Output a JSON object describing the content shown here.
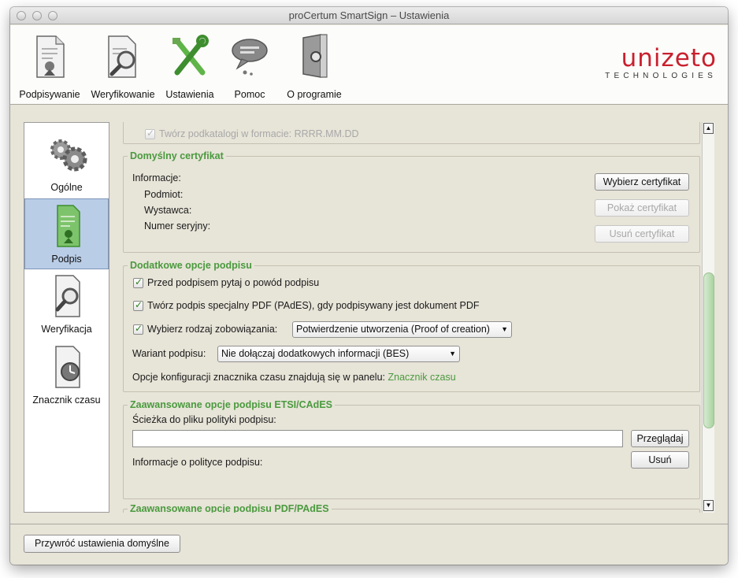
{
  "window": {
    "title": "proCertum SmartSign – Ustawienia"
  },
  "toolbar": {
    "items": [
      {
        "label": "Podpisywanie"
      },
      {
        "label": "Weryfikowanie"
      },
      {
        "label": "Ustawienia"
      },
      {
        "label": "Pomoc"
      },
      {
        "label": "O programie"
      }
    ],
    "logo_brand": "unizeto",
    "logo_sub": "TECHNOLOGIES"
  },
  "sidebar": {
    "items": [
      {
        "label": "Ogólne"
      },
      {
        "label": "Podpis"
      },
      {
        "label": "Weryfikacja"
      },
      {
        "label": "Znacznik czasu"
      }
    ],
    "selected": "Podpis"
  },
  "top_partial": {
    "checkbox_label": "Twórz podkatalogi w formacie: RRRR.MM.DD"
  },
  "default_cert": {
    "title": "Domyślny certyfikat",
    "info_label": "Informacje:",
    "subject_label": "Podmiot:",
    "issuer_label": "Wystawca:",
    "serial_label": "Numer seryjny:",
    "choose_button": "Wybierz certyfikat",
    "show_button": "Pokaż certyfikat",
    "remove_button": "Usuń certyfikat"
  },
  "extra_options": {
    "title": "Dodatkowe opcje podpisu",
    "ask_reason": "Przed podpisem pytaj o powód podpisu",
    "pades": "Twórz podpis specjalny PDF (PAdES), gdy podpisywany jest dokument PDF",
    "commitment_label": "Wybierz rodzaj zobowiązania:",
    "commitment_value": "Potwierdzenie utworzenia (Proof of creation)",
    "variant_label": "Wariant podpisu:",
    "variant_value": "Nie dołączaj dodatkowych informacji (BES)",
    "tsa_text": "Opcje konfiguracji znacznika czasu znajdują się w panelu:",
    "tsa_link": "Znacznik czasu"
  },
  "etsi": {
    "title": "Zaawansowane opcje podpisu ETSI/CAdES",
    "policy_path_label": "Ścieżka do pliku polityki podpisu:",
    "policy_path_value": "",
    "browse_button": "Przeglądaj",
    "policy_info_label": "Informacje o polityce podpisu:",
    "remove_button": "Usuń"
  },
  "pdf_pades": {
    "title": "Zaawansowane opcje podpisu PDF/PAdES"
  },
  "footer": {
    "restore_button": "Przywróć ustawienia domyślne"
  }
}
